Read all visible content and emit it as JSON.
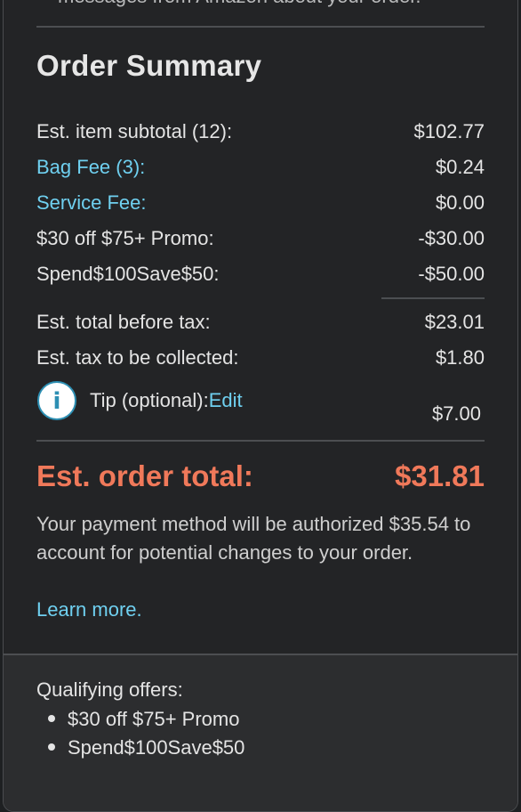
{
  "top_note": "messages from Amazon about your order.",
  "title": "Order Summary",
  "rows": [
    {
      "label": "Est. item subtotal (12):",
      "value": "$102.77"
    },
    {
      "label": "Bag Fee (3):",
      "value": "$0.24"
    },
    {
      "label": "Service Fee:",
      "value": "$0.00"
    },
    {
      "label": "$30 off $75+ Promo:",
      "value": "-$30.00"
    },
    {
      "label": "Spend$100Save$50:",
      "value": "-$50.00"
    },
    {
      "label": "Est. total before tax:",
      "value": "$23.01"
    },
    {
      "label": "Est. tax to be collected:",
      "value": "$1.80"
    }
  ],
  "tip": {
    "icon": "info-icon",
    "icon_glyph": "i",
    "label": "Tip (optional):",
    "edit_label": "Edit",
    "value": "$7.00"
  },
  "total": {
    "label": "Est. order total:",
    "value": "$31.81"
  },
  "authorization_text": "Your payment method will be authorized $35.54 to account for potential changes to your order.",
  "learn_more": "Learn more.",
  "qualifying": {
    "title": "Qualifying offers:",
    "offers": [
      "$30 off $75+ Promo",
      "Spend$100Save$50"
    ]
  },
  "colors": {
    "background": "#232426",
    "link": "#6fd0f0",
    "total": "#f0795a",
    "text": "#e4e4e4"
  }
}
